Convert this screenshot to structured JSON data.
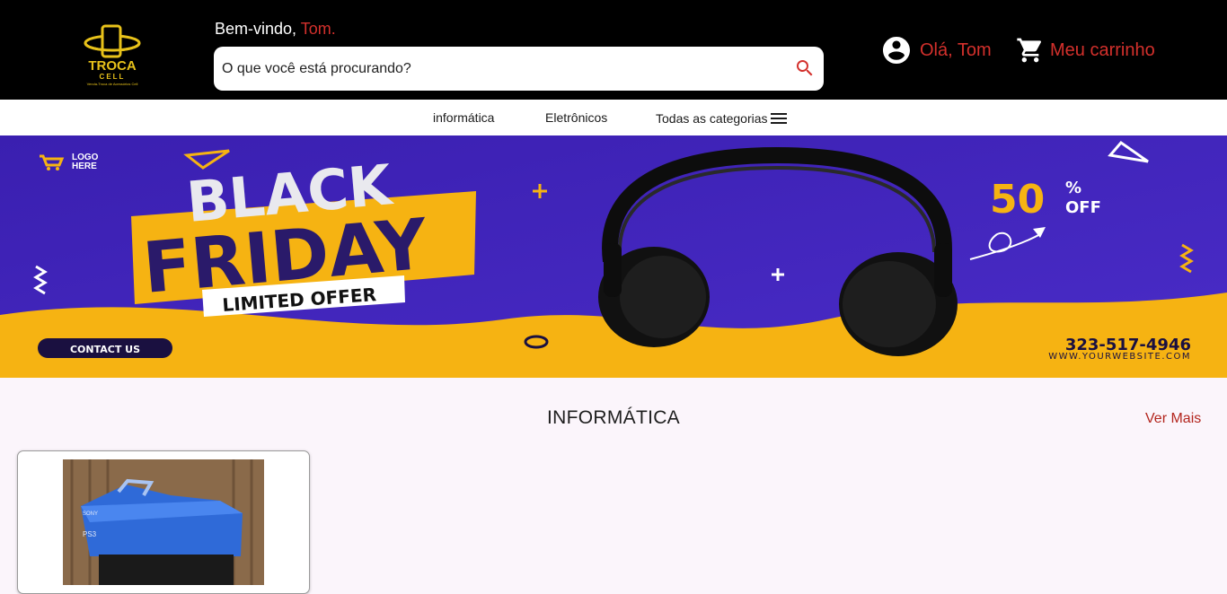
{
  "header": {
    "logo_title": "TROCA",
    "logo_subtitle": "CELL",
    "logo_tagline": "Venda-Troca de Acessórios Cell",
    "welcome_text": "Bem-vindo,",
    "welcome_name": "Tom.",
    "search_placeholder": "O que você está procurando?",
    "search_icon": "search-icon",
    "user_label": "Olá, Tom",
    "user_icon": "account-circle-icon",
    "cart_label": "Meu carrinho",
    "cart_icon": "shopping-cart-icon"
  },
  "nav": {
    "items": [
      {
        "label": "informática"
      },
      {
        "label": "Eletrônicos"
      }
    ],
    "all_label": "Todas as categorias",
    "all_icon": "menu-icon"
  },
  "banner": {
    "logo_text_1": "LOGO",
    "logo_text_2": "HERE",
    "headline_1": "BLACK",
    "headline_2": "FRIDAY",
    "tag": "LIMITED OFFER",
    "discount": "50",
    "percent": "%",
    "off": "OFF",
    "cta": "CONTACT US",
    "phone": "323-517-4946",
    "website": "WWW.YOURWEBSITE.COM"
  },
  "section": {
    "title": "INFORMÁTICA",
    "see_more": "Ver Mais"
  },
  "product": {
    "brand": "SONY",
    "model": "PS3"
  },
  "colors": {
    "accent": "#d3302c",
    "header_bg": "#000000",
    "banner_purple": "#3c22b4",
    "banner_yellow": "#f6b312",
    "page_bg": "#fbf5fb"
  }
}
